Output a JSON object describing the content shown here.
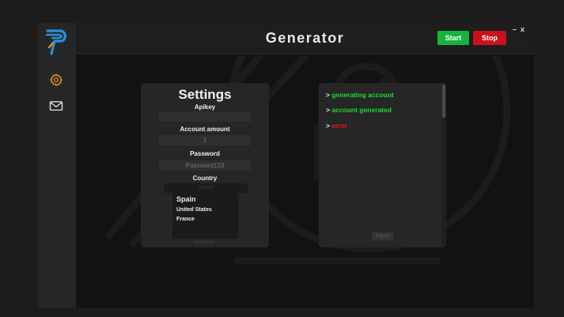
{
  "app": {
    "title": "Generator",
    "start_label": "Start",
    "stop_label": "Stop",
    "minimize_label": "–",
    "close_label": "x"
  },
  "sidebar": {
    "items": [
      {
        "icon": "gear-icon",
        "active": true
      },
      {
        "icon": "mail-icon",
        "active": false
      }
    ]
  },
  "settings": {
    "title": "Settings",
    "apikey_label": "Apikey",
    "apikey_value": "",
    "account_amount_label": "Account amount",
    "account_amount_placeholder": "1",
    "password_label": "Password",
    "password_placeholder": "Password123",
    "country_label": "Country",
    "country_select_label": "Select",
    "country_options": [
      "Spain",
      "United States",
      "France"
    ]
  },
  "console": {
    "logs": [
      {
        "prefix": ">",
        "text": "generating account",
        "status": "success"
      },
      {
        "prefix": ">",
        "text": "account generated",
        "status": "success"
      },
      {
        "prefix": ">",
        "text": "error",
        "status": "error"
      }
    ],
    "export_label": "Export"
  },
  "colors": {
    "start": "#18b33e",
    "stop": "#c8111a",
    "success": "#1fdc2b",
    "error": "#e01a1a",
    "accent": "#d4922a",
    "logo_blue": "#2a8fe0"
  }
}
